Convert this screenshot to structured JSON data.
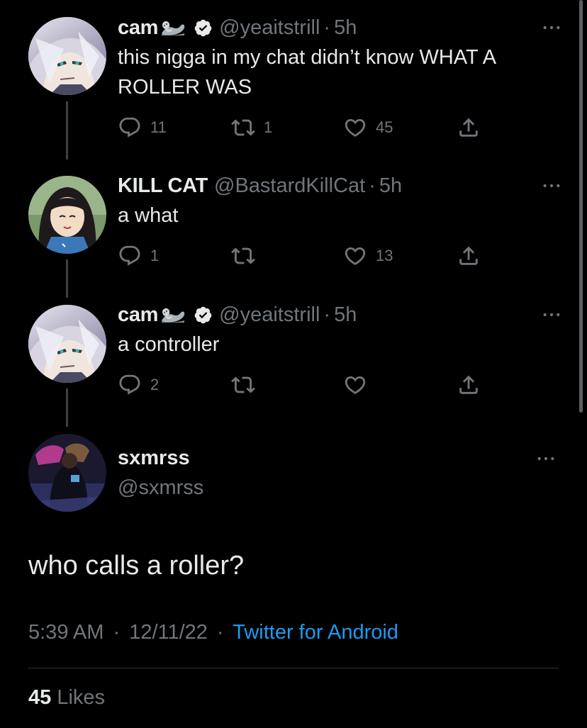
{
  "thread": [
    {
      "name": "cam",
      "emoji": "seal-emoji",
      "verified": true,
      "handle": "@yeaitstrill",
      "separator": "·",
      "time": "5h",
      "text": "this nigga in my chat didn’t know WHAT A ROLLER WAS",
      "replies": "11",
      "retweets": "1",
      "likes": "45"
    },
    {
      "name": "KILL CAT",
      "verified": false,
      "handle": "@BastardKillCat",
      "separator": "·",
      "time": "5h",
      "text": "a what",
      "replies": "1",
      "retweets": "",
      "likes": "13"
    },
    {
      "name": "cam",
      "emoji": "seal-emoji",
      "verified": true,
      "handle": "@yeaitstrill",
      "separator": "·",
      "time": "5h",
      "text": "a controller",
      "replies": "2",
      "retweets": "",
      "likes": ""
    }
  ],
  "focus": {
    "name": "sxmrss",
    "handle": "@sxmrss",
    "text": "who calls a roller?",
    "time": "5:39 AM",
    "separator": "·",
    "date": "12/11/22",
    "source": "Twitter for Android",
    "like_count": "45",
    "like_label": "Likes"
  },
  "icons": {
    "reply": "reply-icon",
    "retweet": "retweet-icon",
    "like": "heart-icon",
    "share": "share-icon",
    "more": "more-options-icon",
    "verified": "verified-badge-icon"
  },
  "colors": {
    "background": "#000000",
    "text": "#e7e9ea",
    "secondary": "#71767b",
    "accent": "#1d9bf0",
    "thread_line": "#3e4144"
  }
}
